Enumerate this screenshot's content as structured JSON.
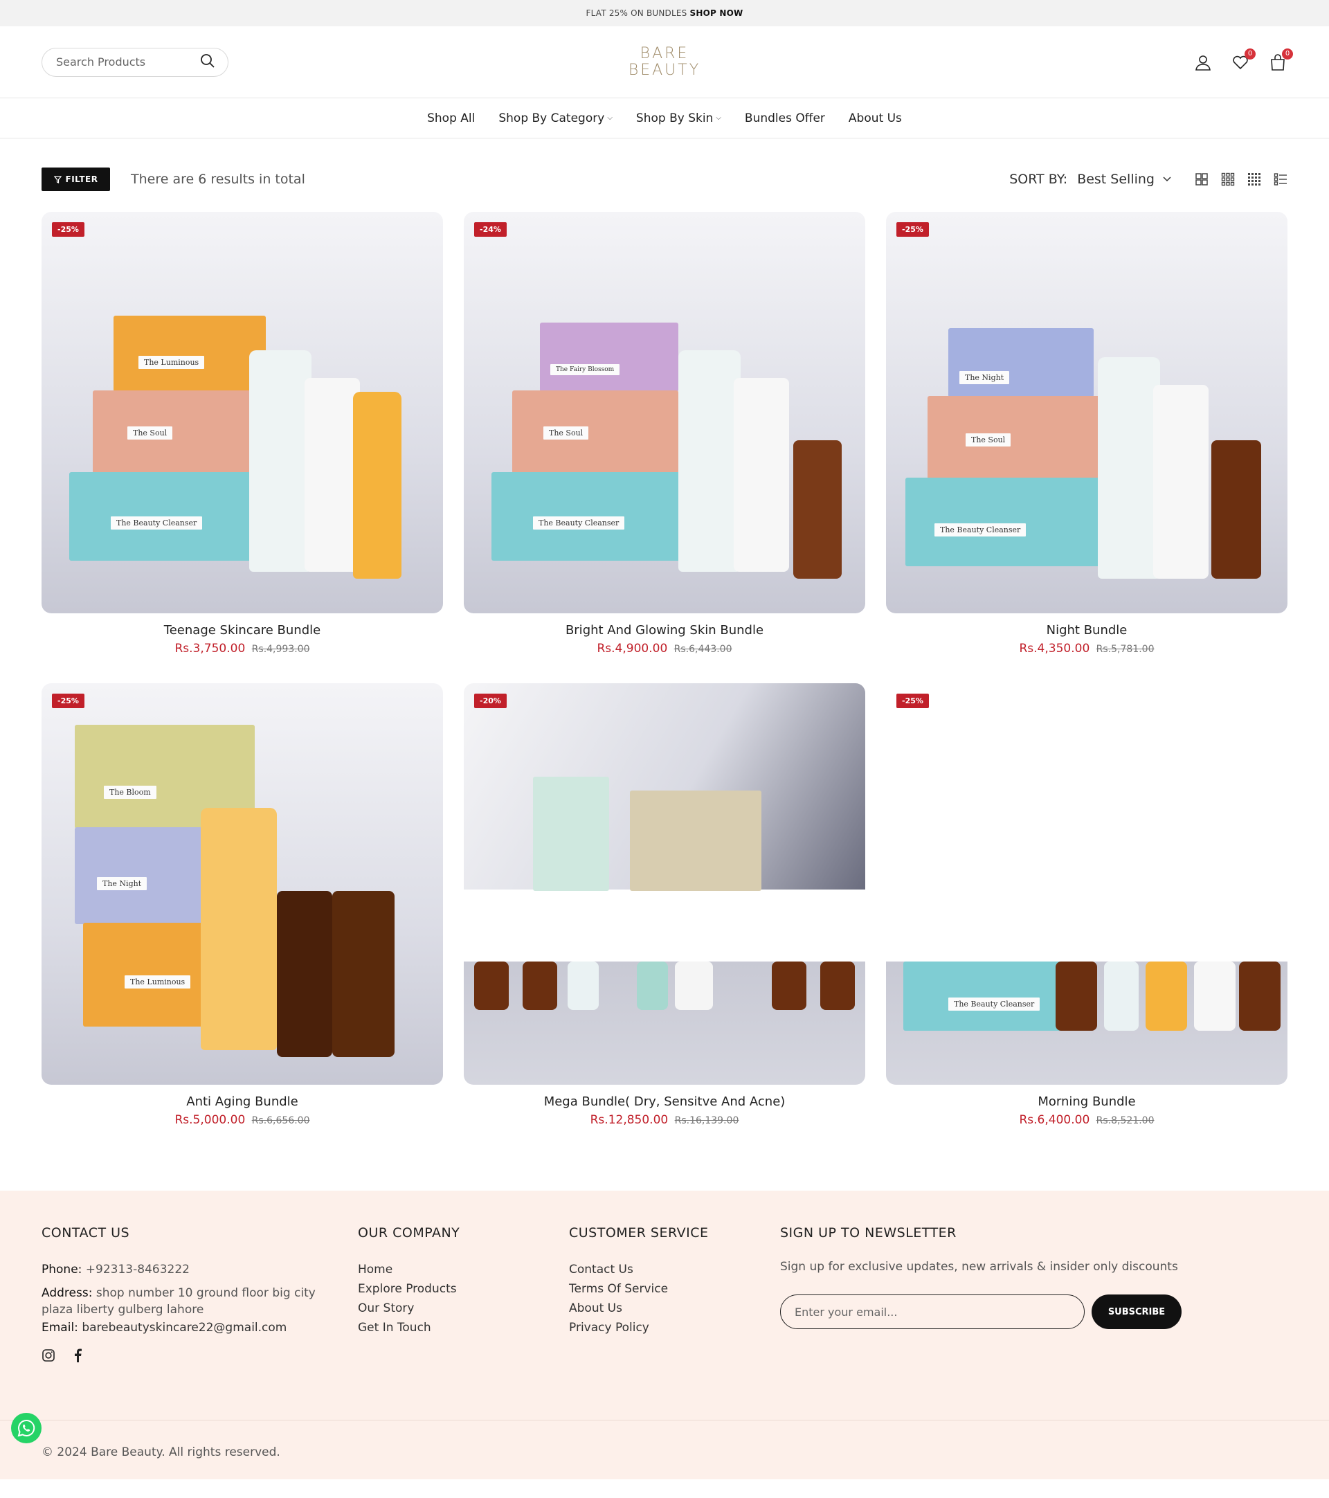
{
  "announcement": {
    "text": "FLAT 25% ON BUNDLES",
    "link": "SHOP NOW"
  },
  "header": {
    "search_placeholder": "Search Products",
    "logo_line1": "BARE",
    "logo_line2": "BEAUTY",
    "wishlist_count": "0",
    "cart_count": "0"
  },
  "nav": {
    "items": [
      {
        "label": "Shop All"
      },
      {
        "label": "Shop By Category",
        "dropdown": true
      },
      {
        "label": "Shop By Skin",
        "dropdown": true
      },
      {
        "label": "Bundles Offer"
      },
      {
        "label": "About Us"
      }
    ]
  },
  "toolbar": {
    "filter_label": "FILTER",
    "results_text": "There are 6 results in total",
    "sort_label": "SORT BY:",
    "sort_value": "Best Selling"
  },
  "products": [
    {
      "title": "Teenage Skincare Bundle",
      "price": "Rs.3,750.00",
      "old_price": "Rs.4,993.00",
      "discount": "-25%"
    },
    {
      "title": "Bright And Glowing Skin Bundle",
      "price": "Rs.4,900.00",
      "old_price": "Rs.6,443.00",
      "discount": "-24%"
    },
    {
      "title": "Night Bundle",
      "price": "Rs.4,350.00",
      "old_price": "Rs.5,781.00",
      "discount": "-25%"
    },
    {
      "title": "Anti Aging Bundle",
      "price": "Rs.5,000.00",
      "old_price": "Rs.6,656.00",
      "discount": "-25%"
    },
    {
      "title": "Mega Bundle( Dry, Sensitve And Acne)",
      "price": "Rs.12,850.00",
      "old_price": "Rs.16,139.00",
      "discount": "-20%"
    },
    {
      "title": "Morning Bundle",
      "price": "Rs.6,400.00",
      "old_price": "Rs.8,521.00",
      "discount": "-25%"
    }
  ],
  "labels": {
    "luminous": "The Luminous",
    "soul": "The Soul",
    "cleanser": "The Beauty Cleanser",
    "fairy": "The Fairy Blossom",
    "night": "The Night",
    "bloom": "The Bloom"
  },
  "footer": {
    "contact": {
      "heading": "CONTACT US",
      "phone_label": "Phone:",
      "phone": "+92313-8463222",
      "address_label": "Address:",
      "address": "shop number 10 ground floor big city plaza liberty gulberg lahore",
      "email_label": "Email:",
      "email": "barebeautyskincare22@gmail.com"
    },
    "company": {
      "heading": "OUR COMPANY",
      "links": [
        "Home",
        "Explore Products",
        "Our Story",
        "Get In Touch"
      ]
    },
    "service": {
      "heading": "CUSTOMER SERVICE",
      "links": [
        "Contact Us",
        "Terms Of Service",
        "About Us",
        "Privacy Policy"
      ]
    },
    "newsletter": {
      "heading": "SIGN UP TO NEWSLETTER",
      "text": "Sign up for exclusive updates, new arrivals & insider only discounts",
      "placeholder": "Enter your email...",
      "button": "SUBSCRIBE"
    },
    "copyright": "© 2024 Bare Beauty. All rights reserved."
  },
  "colors": {
    "accent_red": "#c1202a",
    "logo_gold": "#a08c6a",
    "footer_bg": "#fdf0ea"
  }
}
